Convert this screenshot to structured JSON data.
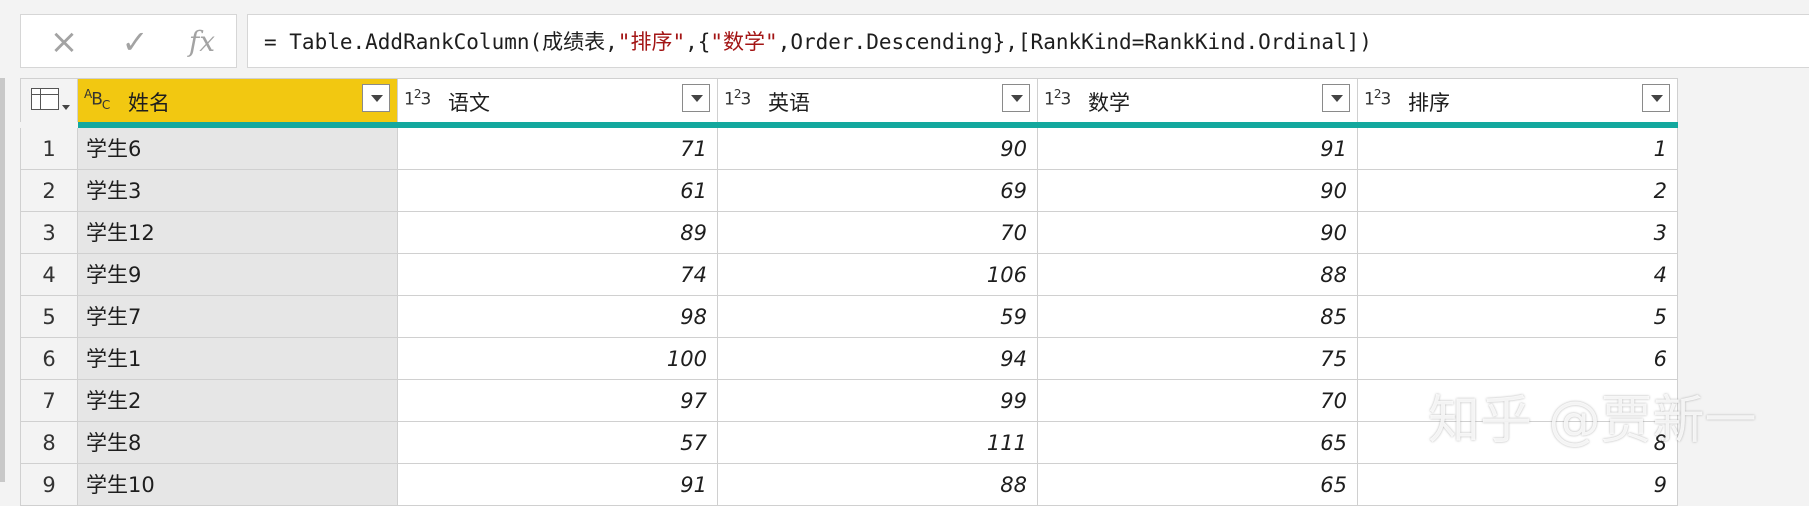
{
  "formula_bar": {
    "cancel_icon": "×",
    "check_icon": "✓",
    "fx_label": "fx",
    "formula_prefix": "= Table.AddRankColumn(成绩表,",
    "formula_str1": "\"排序\"",
    "formula_mid": ",{",
    "formula_str2": "\"数学\"",
    "formula_suffix": ",Order.Descending},[RankKind=RankKind.Ordinal])"
  },
  "columns": [
    {
      "type_icon": "ABC",
      "label": "姓名"
    },
    {
      "type_icon": "123",
      "label": "语文"
    },
    {
      "type_icon": "123",
      "label": "英语"
    },
    {
      "type_icon": "123",
      "label": "数学"
    },
    {
      "type_icon": "123",
      "label": "排序"
    }
  ],
  "rows": [
    {
      "idx": "1",
      "name": "学生6",
      "c1": "71",
      "c2": "90",
      "c3": "91",
      "c4": "1"
    },
    {
      "idx": "2",
      "name": "学生3",
      "c1": "61",
      "c2": "69",
      "c3": "90",
      "c4": "2"
    },
    {
      "idx": "3",
      "name": "学生12",
      "c1": "89",
      "c2": "70",
      "c3": "90",
      "c4": "3"
    },
    {
      "idx": "4",
      "name": "学生9",
      "c1": "74",
      "c2": "106",
      "c3": "88",
      "c4": "4"
    },
    {
      "idx": "5",
      "name": "学生7",
      "c1": "98",
      "c2": "59",
      "c3": "85",
      "c4": "5"
    },
    {
      "idx": "6",
      "name": "学生1",
      "c1": "100",
      "c2": "94",
      "c3": "75",
      "c4": "6"
    },
    {
      "idx": "7",
      "name": "学生2",
      "c1": "97",
      "c2": "99",
      "c3": "70",
      "c4": ""
    },
    {
      "idx": "8",
      "name": "学生8",
      "c1": "57",
      "c2": "111",
      "c3": "65",
      "c4": "8"
    },
    {
      "idx": "9",
      "name": "学生10",
      "c1": "91",
      "c2": "88",
      "c3": "65",
      "c4": "9"
    }
  ],
  "watermark": "知乎 @贾新一",
  "colors": {
    "header_selected": "#f2c811",
    "quality_bar": "#13a89e"
  }
}
